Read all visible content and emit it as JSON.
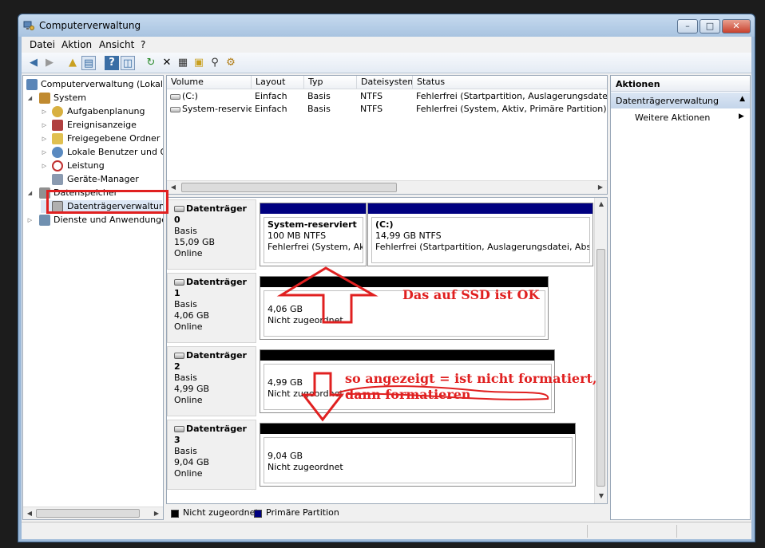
{
  "window": {
    "title": "Computerverwaltung",
    "btn_minimize": "–",
    "btn_maximize": "□",
    "btn_close": "✕"
  },
  "menu": [
    "Datei",
    "Aktion",
    "Ansicht",
    "?"
  ],
  "toolbar_icons": [
    "arrow-left-icon",
    "arrow-right-icon",
    "folder-up-icon",
    "console-tree-icon",
    "help-icon",
    "show-pane-icon",
    "refresh-icon",
    "delete-icon",
    "properties-icon",
    "open-icon",
    "search-icon",
    "settings-icon"
  ],
  "tree": {
    "root": "Computerverwaltung (Lokal)",
    "system": "System",
    "system_children": [
      "Aufgabenplanung",
      "Ereignisanzeige",
      "Freigegebene Ordner",
      "Lokale Benutzer und Gr",
      "Leistung",
      "Geräte-Manager"
    ],
    "storage": "Datenspeicher",
    "storage_child": "Datenträgerverwaltung",
    "services": "Dienste und Anwendungen"
  },
  "volumes": {
    "columns": [
      "Volume",
      "Layout",
      "Typ",
      "Dateisystem",
      "Status"
    ],
    "rows": [
      [
        "(C:)",
        "Einfach",
        "Basis",
        "NTFS",
        "Fehlerfrei (Startpartition, Auslagerungsdatei, Abs"
      ],
      [
        "System-reserviert",
        "Einfach",
        "Basis",
        "NTFS",
        "Fehlerfrei (System, Aktiv, Primäre Partition)"
      ]
    ]
  },
  "disks": [
    {
      "title": "Datenträger 0",
      "type": "Basis",
      "size": "15,09 GB",
      "state": "Online",
      "partitions": [
        {
          "name": "System-reserviert",
          "size": "100 MB NTFS",
          "status": "Fehlerfrei (System, Aktiv,",
          "kind": "primary"
        },
        {
          "name": "(C:)",
          "size": "14,99 GB NTFS",
          "status": "Fehlerfrei (Startpartition, Auslagerungsdatei, Absturzab",
          "kind": "primary"
        }
      ]
    },
    {
      "title": "Datenträger 1",
      "type": "Basis",
      "size": "4,06 GB",
      "state": "Online",
      "partitions": [
        {
          "name": "",
          "size": "4,06 GB",
          "status": "Nicht zugeordnet",
          "kind": "unallocated"
        }
      ]
    },
    {
      "title": "Datenträger 2",
      "type": "Basis",
      "size": "4,99 GB",
      "state": "Online",
      "partitions": [
        {
          "name": "",
          "size": "4,99 GB",
          "status": "Nicht zugeordnet",
          "kind": "unallocated"
        }
      ]
    },
    {
      "title": "Datenträger 3",
      "type": "Basis",
      "size": "9,04 GB",
      "state": "Online",
      "partitions": [
        {
          "name": "",
          "size": "9,04 GB",
          "status": "Nicht zugeordnet",
          "kind": "unallocated"
        }
      ]
    }
  ],
  "legend": {
    "unallocated": "Nicht zugeordnet",
    "primary": "Primäre Partition"
  },
  "actions": {
    "title": "Aktionen",
    "section": "Datenträgerverwaltung",
    "item": "Weitere Aktionen"
  },
  "colors": {
    "primary_partition": "#000080",
    "unallocated": "#000000",
    "annotation": "#e02020"
  },
  "annotations": {
    "ssd_ok": "Das auf SSD ist OK",
    "not_formatted_line1": "so angezeigt = ist nicht formatiert,",
    "not_formatted_line2": "dann formatieren"
  }
}
